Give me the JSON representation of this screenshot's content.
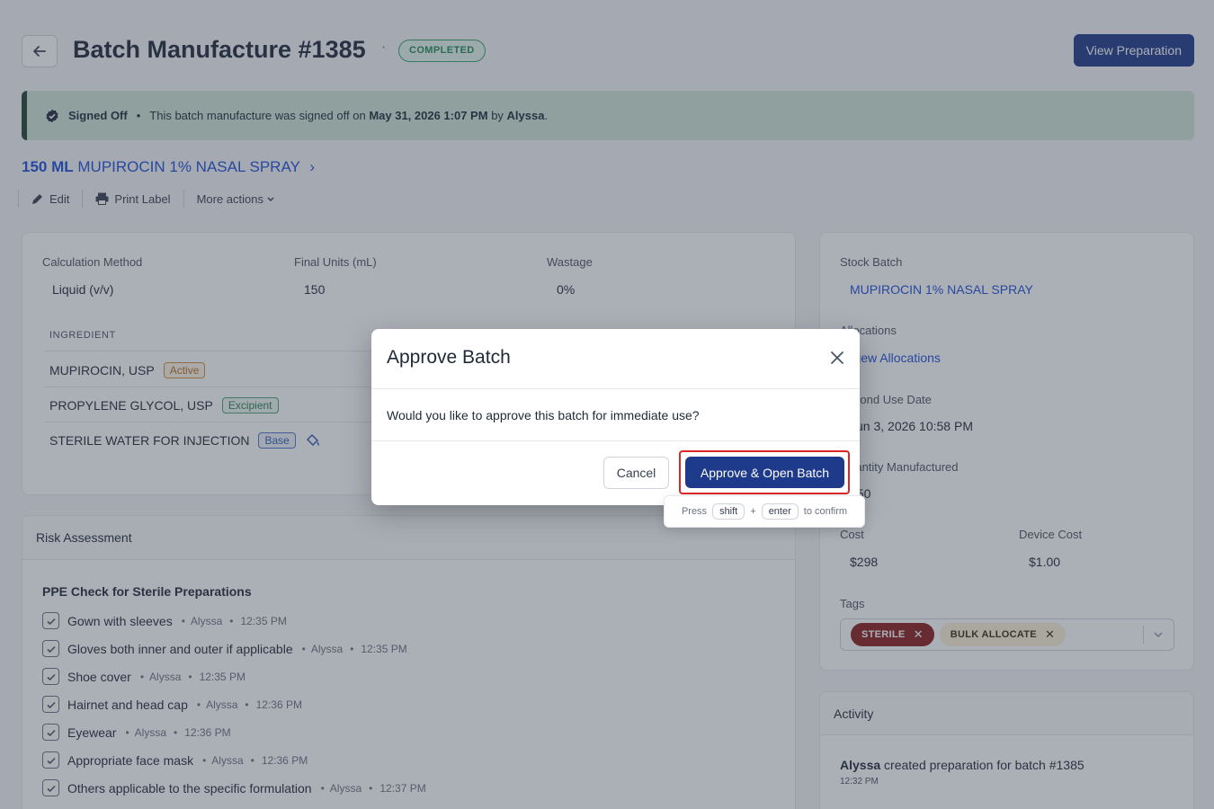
{
  "header": {
    "title": "Batch Manufacture #1385",
    "dot": "·",
    "status": "COMPLETED",
    "view_preparation": "View Preparation"
  },
  "banner": {
    "label": "Signed Off",
    "bullet": "•",
    "text_prefix": "This batch manufacture was signed off on",
    "date": "May 31, 2026 1:07 PM",
    "by_word": "by",
    "user": "Alyssa",
    "period": "."
  },
  "product": {
    "qty": "150 ML",
    "name": "MUPIROCIN 1% NASAL SPRAY",
    "chevron": "›"
  },
  "actions": {
    "edit": "Edit",
    "print": "Print Label",
    "more": "More actions"
  },
  "main": {
    "calc_method_label": "Calculation Method",
    "calc_method_value": "Liquid (v/v)",
    "final_units_label": "Final Units (mL)",
    "final_units_value": "150",
    "wastage_label": "Wastage",
    "wastage_value": "0%",
    "ingredient_header": "INGREDIENT",
    "ingredients": [
      {
        "name": "MUPIROCIN, USP",
        "tag": "Active"
      },
      {
        "name": "PROPYLENE GLYCOL, USP",
        "tag": "Excipient"
      },
      {
        "name": "STERILE WATER FOR INJECTION",
        "tag": "Base"
      }
    ]
  },
  "stock": {
    "stock_batch_label": "Stock Batch",
    "stock_batch_value": "MUPIROCIN 1% NASAL SPRAY",
    "allocations_label": "Allocations",
    "allocations_link": "View Allocations",
    "bud_label": "Beyond Use Date",
    "bud_value": "Jun 3, 2026 10:58 PM",
    "qty_label": "Quantity Manufactured",
    "qty_value": "150",
    "cost_label": "Cost",
    "cost_value": "$298",
    "device_cost_label": "Device Cost",
    "device_cost_value": "$1.00",
    "tags_label": "Tags",
    "tags": [
      "STERILE",
      "BULK ALLOCATE"
    ],
    "tag_remove": "✕"
  },
  "risk": {
    "title": "Risk Assessment",
    "ppe_title": "PPE Check for Sterile Preparations",
    "items": [
      {
        "label": "Gown with sleeves",
        "user": "Alyssa",
        "time": "12:35 PM"
      },
      {
        "label": "Gloves both inner and outer if applicable",
        "user": "Alyssa",
        "time": "12:35 PM"
      },
      {
        "label": "Shoe cover",
        "user": "Alyssa",
        "time": "12:35 PM"
      },
      {
        "label": "Hairnet and head cap",
        "user": "Alyssa",
        "time": "12:36 PM"
      },
      {
        "label": "Eyewear",
        "user": "Alyssa",
        "time": "12:36 PM"
      },
      {
        "label": "Appropriate face mask",
        "user": "Alyssa",
        "time": "12:36 PM"
      },
      {
        "label": "Others applicable to the specific formulation",
        "user": "Alyssa",
        "time": "12:37 PM"
      }
    ],
    "bullet": "•"
  },
  "activity": {
    "title": "Activity",
    "user": "Alyssa",
    "text": "created preparation for batch #1385",
    "time": "12:32 PM"
  },
  "modal": {
    "title": "Approve Batch",
    "message": "Would you like to approve this batch for immediate use?",
    "cancel": "Cancel",
    "approve": "Approve & Open Batch"
  },
  "hint": {
    "press": "Press",
    "key1": "shift",
    "plus": "+",
    "key2": "enter",
    "suffix": "to confirm"
  },
  "colors": {
    "primary": "#1e3a8a",
    "link": "#1d4ed8",
    "success": "#1f8a55",
    "highlight": "#dc2626"
  }
}
